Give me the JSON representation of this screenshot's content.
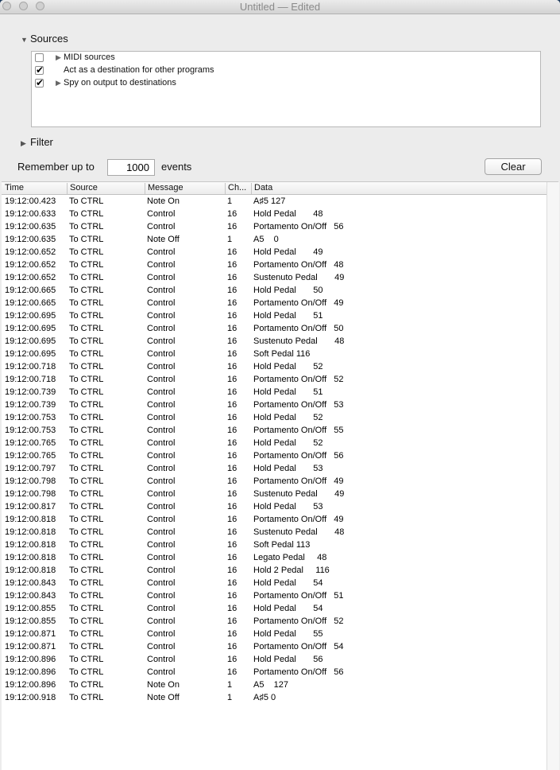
{
  "window": {
    "title": "Untitled",
    "title_suffix": "— Edited"
  },
  "sources": {
    "heading": "Sources",
    "items": [
      {
        "label": "MIDI sources",
        "checked": false,
        "expandable": true
      },
      {
        "label": "Act as a destination for other programs",
        "checked": true,
        "expandable": false
      },
      {
        "label": "Spy on output to destinations",
        "checked": true,
        "expandable": true
      }
    ]
  },
  "filter": {
    "heading": "Filter"
  },
  "remember": {
    "prefix": "Remember up to",
    "value": "1000",
    "suffix": "events"
  },
  "clear_label": "Clear",
  "table": {
    "columns": [
      "Time",
      "Source",
      "Message",
      "Ch...",
      "Data"
    ],
    "rows": [
      [
        "19:12:00.423",
        "To CTRL",
        "Note On",
        "1",
        "A♯5 127"
      ],
      [
        "19:12:00.633",
        "To CTRL",
        "Control",
        "16",
        "Hold Pedal       48"
      ],
      [
        "19:12:00.635",
        "To CTRL",
        "Control",
        "16",
        "Portamento On/Off   56"
      ],
      [
        "19:12:00.635",
        "To CTRL",
        "Note Off",
        "1",
        "A5    0"
      ],
      [
        "19:12:00.652",
        "To CTRL",
        "Control",
        "16",
        "Hold Pedal       49"
      ],
      [
        "19:12:00.652",
        "To CTRL",
        "Control",
        "16",
        "Portamento On/Off   48"
      ],
      [
        "19:12:00.652",
        "To CTRL",
        "Control",
        "16",
        "Sustenuto Pedal       49"
      ],
      [
        "19:12:00.665",
        "To CTRL",
        "Control",
        "16",
        "Hold Pedal       50"
      ],
      [
        "19:12:00.665",
        "To CTRL",
        "Control",
        "16",
        "Portamento On/Off   49"
      ],
      [
        "19:12:00.695",
        "To CTRL",
        "Control",
        "16",
        "Hold Pedal       51"
      ],
      [
        "19:12:00.695",
        "To CTRL",
        "Control",
        "16",
        "Portamento On/Off   50"
      ],
      [
        "19:12:00.695",
        "To CTRL",
        "Control",
        "16",
        "Sustenuto Pedal       48"
      ],
      [
        "19:12:00.695",
        "To CTRL",
        "Control",
        "16",
        "Soft Pedal 116"
      ],
      [
        "19:12:00.718",
        "To CTRL",
        "Control",
        "16",
        "Hold Pedal       52"
      ],
      [
        "19:12:00.718",
        "To CTRL",
        "Control",
        "16",
        "Portamento On/Off   52"
      ],
      [
        "19:12:00.739",
        "To CTRL",
        "Control",
        "16",
        "Hold Pedal       51"
      ],
      [
        "19:12:00.739",
        "To CTRL",
        "Control",
        "16",
        "Portamento On/Off   53"
      ],
      [
        "19:12:00.753",
        "To CTRL",
        "Control",
        "16",
        "Hold Pedal       52"
      ],
      [
        "19:12:00.753",
        "To CTRL",
        "Control",
        "16",
        "Portamento On/Off   55"
      ],
      [
        "19:12:00.765",
        "To CTRL",
        "Control",
        "16",
        "Hold Pedal       52"
      ],
      [
        "19:12:00.765",
        "To CTRL",
        "Control",
        "16",
        "Portamento On/Off   56"
      ],
      [
        "19:12:00.797",
        "To CTRL",
        "Control",
        "16",
        "Hold Pedal       53"
      ],
      [
        "19:12:00.798",
        "To CTRL",
        "Control",
        "16",
        "Portamento On/Off   49"
      ],
      [
        "19:12:00.798",
        "To CTRL",
        "Control",
        "16",
        "Sustenuto Pedal       49"
      ],
      [
        "19:12:00.817",
        "To CTRL",
        "Control",
        "16",
        "Hold Pedal       53"
      ],
      [
        "19:12:00.818",
        "To CTRL",
        "Control",
        "16",
        "Portamento On/Off   49"
      ],
      [
        "19:12:00.818",
        "To CTRL",
        "Control",
        "16",
        "Sustenuto Pedal       48"
      ],
      [
        "19:12:00.818",
        "To CTRL",
        "Control",
        "16",
        "Soft Pedal 113"
      ],
      [
        "19:12:00.818",
        "To CTRL",
        "Control",
        "16",
        "Legato Pedal     48"
      ],
      [
        "19:12:00.818",
        "To CTRL",
        "Control",
        "16",
        "Hold 2 Pedal     116"
      ],
      [
        "19:12:00.843",
        "To CTRL",
        "Control",
        "16",
        "Hold Pedal       54"
      ],
      [
        "19:12:00.843",
        "To CTRL",
        "Control",
        "16",
        "Portamento On/Off   51"
      ],
      [
        "19:12:00.855",
        "To CTRL",
        "Control",
        "16",
        "Hold Pedal       54"
      ],
      [
        "19:12:00.855",
        "To CTRL",
        "Control",
        "16",
        "Portamento On/Off   52"
      ],
      [
        "19:12:00.871",
        "To CTRL",
        "Control",
        "16",
        "Hold Pedal       55"
      ],
      [
        "19:12:00.871",
        "To CTRL",
        "Control",
        "16",
        "Portamento On/Off   54"
      ],
      [
        "19:12:00.896",
        "To CTRL",
        "Control",
        "16",
        "Hold Pedal       56"
      ],
      [
        "19:12:00.896",
        "To CTRL",
        "Control",
        "16",
        "Portamento On/Off   56"
      ],
      [
        "19:12:00.896",
        "To CTRL",
        "Note On",
        "1",
        "A5    127"
      ],
      [
        "19:12:00.918",
        "To CTRL",
        "Note Off",
        "1",
        "A♯5 0"
      ]
    ]
  },
  "icons": {
    "close": "close-button-icon",
    "minimize": "minimize-button-icon",
    "zoom": "zoom-button-icon",
    "expanded": "triangle-down-icon",
    "collapsed": "triangle-right-icon",
    "checkmark": "checkmark-icon"
  }
}
